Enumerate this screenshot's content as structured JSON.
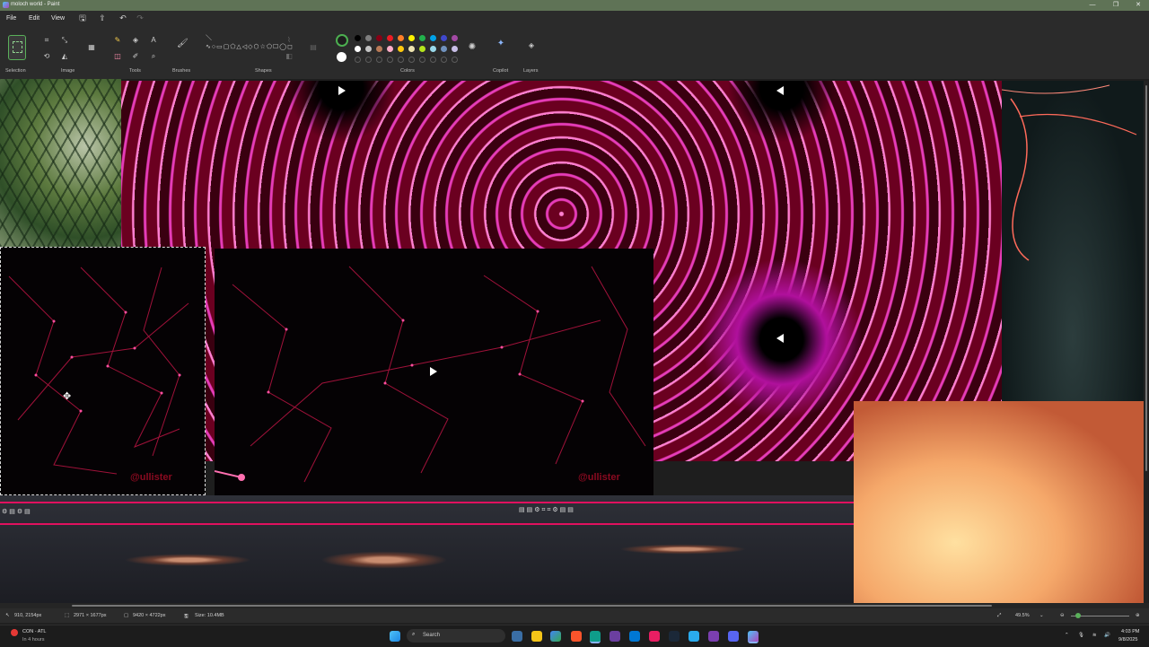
{
  "window": {
    "title": "moloch world - Paint",
    "controls": {
      "minimize": "—",
      "restore": "❐",
      "close": "✕"
    }
  },
  "menu": {
    "file": "File",
    "edit": "Edit",
    "view": "View"
  },
  "ribbon": {
    "groups": {
      "selection": "Selection",
      "image": "Image",
      "tools": "Tools",
      "brushes": "Brushes",
      "shapes": "Shapes",
      "colors": "Colors",
      "copilot": "Copilot",
      "layers": "Layers"
    },
    "shape_glyphs": "＼∿○▭▢⬠△◁◇⬡☆⬠☐◯◻",
    "palette_row1": [
      "#000000",
      "#7f7f7f",
      "#880015",
      "#ed1c24",
      "#ff7f27",
      "#fff200",
      "#22b14c",
      "#00a2e8",
      "#3f48cc",
      "#a349a4"
    ],
    "palette_row2": [
      "#ffffff",
      "#c3c3c3",
      "#b97a57",
      "#ffaec9",
      "#ffc90e",
      "#efe4b0",
      "#b5e61d",
      "#99d9ea",
      "#7092be",
      "#c8bfe7"
    ],
    "primary_color": "#1e1e1e",
    "secondary_color": "#ffffff"
  },
  "status": {
    "cursor_pos": "910, 2154px",
    "selection_size": "2971 × 1677px",
    "canvas_size": "9420 × 4722px",
    "file_size": "Size: 10.4MB",
    "zoom": "49.5%"
  },
  "taskbar": {
    "weather_title": "CON - ATL",
    "weather_sub": "In 4 hours",
    "search_placeholder": "Search",
    "time": "4:03 PM",
    "date": "9/8/2025"
  },
  "canvas": {
    "watermark_text": "@ullister",
    "accent_color": "#e0115f"
  }
}
